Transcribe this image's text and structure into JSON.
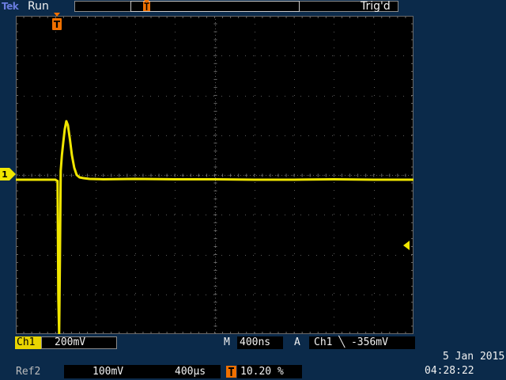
{
  "header": {
    "brand": "Tek",
    "acq_state": "Run",
    "trigger_status": "Trig'd"
  },
  "markers": {
    "trigger_marker_letter": "T",
    "channel_marker_label": "1"
  },
  "colors": {
    "ch1": "#f0e600",
    "trigger": "#f07000",
    "ui_background": "#0b2a4a",
    "screen_background": "#000000"
  },
  "readouts": {
    "ch1_tag": "Ch1",
    "ch1_scale": "200mV",
    "timebase_label": "M",
    "timebase_value": "400ns",
    "trigger_mode_label": "A",
    "trigger_source": "Ch1",
    "trigger_slope_icon": "falling-edge-icon",
    "trigger_slope_glyph": "╲",
    "trigger_level": "-356mV",
    "ref_label": "Ref2",
    "ref_volts": "100mV",
    "ref_time": "400µs",
    "horizontal_position": "10.20 %",
    "date": "5 Jan  2015",
    "time": "04:28:22"
  },
  "chart_data": {
    "type": "line",
    "title": "",
    "xlabel": "",
    "ylabel": "",
    "units": {
      "x": "div",
      "y": "div"
    },
    "xlim": [
      0,
      10
    ],
    "ylim": [
      -4,
      4
    ],
    "series": [
      {
        "color": "#f0e600",
        "points": [
          [
            0.0,
            -0.02
          ],
          [
            1.0,
            -0.02
          ],
          [
            1.02,
            -0.04
          ],
          [
            1.05,
            -0.05
          ],
          [
            1.07,
            -3.0
          ],
          [
            1.09,
            -3.9
          ],
          [
            1.11,
            -2.0
          ],
          [
            1.13,
            0.2
          ],
          [
            1.16,
            0.6
          ],
          [
            1.19,
            0.9
          ],
          [
            1.23,
            1.25
          ],
          [
            1.27,
            1.45
          ],
          [
            1.31,
            1.35
          ],
          [
            1.36,
            1.0
          ],
          [
            1.41,
            0.6
          ],
          [
            1.47,
            0.28
          ],
          [
            1.53,
            0.1
          ],
          [
            1.6,
            0.04
          ],
          [
            1.7,
            0.02
          ],
          [
            1.85,
            0.0
          ],
          [
            2.2,
            -0.01
          ],
          [
            3.0,
            0.0
          ],
          [
            4.0,
            -0.01
          ],
          [
            5.0,
            -0.01
          ],
          [
            6.0,
            -0.02
          ],
          [
            7.0,
            -0.02
          ],
          [
            8.0,
            -0.01
          ],
          [
            9.0,
            -0.02
          ],
          [
            10.0,
            -0.02
          ]
        ]
      }
    ]
  }
}
